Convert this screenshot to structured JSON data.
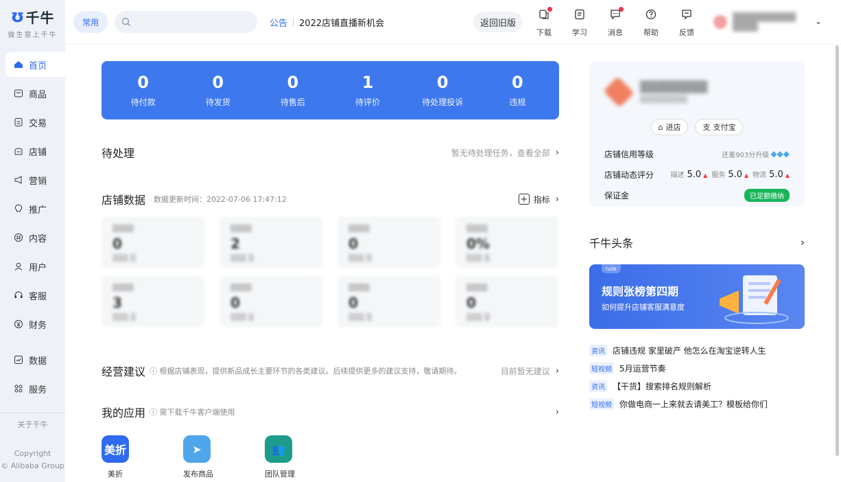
{
  "brand": {
    "name": "千牛",
    "slogan": "做生意上千牛"
  },
  "sidebar": {
    "items": [
      {
        "label": "首页",
        "icon": "home-icon"
      },
      {
        "label": "商品",
        "icon": "goods-icon"
      },
      {
        "label": "交易",
        "icon": "trade-icon"
      },
      {
        "label": "店铺",
        "icon": "shop-icon"
      },
      {
        "label": "营销",
        "icon": "megaphone-icon"
      },
      {
        "label": "推广",
        "icon": "bulb-icon"
      },
      {
        "label": "内容",
        "icon": "hash-icon"
      },
      {
        "label": "用户",
        "icon": "user-icon"
      },
      {
        "label": "客服",
        "icon": "headset-icon"
      },
      {
        "label": "财务",
        "icon": "yen-icon"
      },
      {
        "label": "数据",
        "icon": "chart-icon"
      },
      {
        "label": "服务",
        "icon": "grid-icon"
      }
    ],
    "about": "关于千牛",
    "copyright": "Copyright",
    "company": "© Alibaba Group"
  },
  "topbar": {
    "frequent": "常用",
    "search_placeholder": "",
    "notice_tag": "公告",
    "notice_text": "2022店铺直播新机会",
    "old_version": "返回旧版",
    "tools": [
      {
        "label": "下载",
        "icon": "download-icon",
        "badge": true
      },
      {
        "label": "学习",
        "icon": "book-icon",
        "badge": false
      },
      {
        "label": "消息",
        "icon": "message-icon",
        "badge": true
      },
      {
        "label": "帮助",
        "icon": "help-icon",
        "badge": false
      },
      {
        "label": "反馈",
        "icon": "feedback-icon",
        "badge": false
      }
    ]
  },
  "stats": [
    {
      "value": "0",
      "label": "待付款"
    },
    {
      "value": "0",
      "label": "待发货"
    },
    {
      "value": "0",
      "label": "待售后"
    },
    {
      "value": "1",
      "label": "待评价"
    },
    {
      "value": "0",
      "label": "待处理投诉"
    },
    {
      "value": "0",
      "label": "违规"
    }
  ],
  "pending": {
    "title": "待处理",
    "right": "暂无待处理任务，查看全部"
  },
  "shopdata": {
    "title": "店铺数据",
    "updated": "数据更新时间：2022-07-06 17:47:12",
    "indicator": "指标",
    "cards": [
      {
        "v": "0"
      },
      {
        "v": "2"
      },
      {
        "v": "0"
      },
      {
        "v": "0%"
      },
      {
        "v": "3"
      },
      {
        "v": "0"
      },
      {
        "v": "0"
      },
      {
        "v": "0"
      }
    ]
  },
  "advice": {
    "title": "经营建议",
    "desc": "ⓘ 根据店铺表现，提供新品成长主要环节的各类建议。后续提供更多的建议支持，敬请期待。",
    "right": "目前暂无建议"
  },
  "myapps": {
    "title": "我的应用",
    "desc": "ⓘ 需下载千牛客户端使用",
    "apps": [
      {
        "label": "美折",
        "glyph": "美折",
        "color": "#2f6bf0"
      },
      {
        "label": "发布商品",
        "glyph": "➤",
        "color": "#4ea6ec"
      },
      {
        "label": "团队管理",
        "glyph": "👥",
        "color": "#1e9c8a"
      }
    ]
  },
  "shop": {
    "enter": "进店",
    "alipay": "支付宝",
    "credit_label": "店铺信用等级",
    "credit_right": "还差903分升级",
    "dsr_label": "店铺动态评分",
    "dsr": [
      {
        "k": "描述",
        "v": "5.0"
      },
      {
        "k": "服务",
        "v": "5.0"
      },
      {
        "k": "物流",
        "v": "5.0"
      }
    ],
    "deposit_label": "保证金",
    "deposit_status": "已足额缴纳"
  },
  "headlines": {
    "title": "千牛头条",
    "banner_title": "规则张榜第四期",
    "banner_sub": "如何提升店铺客服满意度",
    "items": [
      {
        "tag": "资讯",
        "text": "店铺违规 家里破产 他怎么在淘宝逆转人生"
      },
      {
        "tag": "短视频",
        "text": "5月运营节奏"
      },
      {
        "tag": "资讯",
        "text": "【干货】搜索排名规则解析"
      },
      {
        "tag": "短视频",
        "text": "你做电商一上来就去请美工？模板给你们"
      }
    ]
  },
  "colors": {
    "accent": "#2f6bf0",
    "stats_bg": "#3d78ee",
    "badge_red": "#f0304a",
    "deposit_green": "#19b55a"
  }
}
